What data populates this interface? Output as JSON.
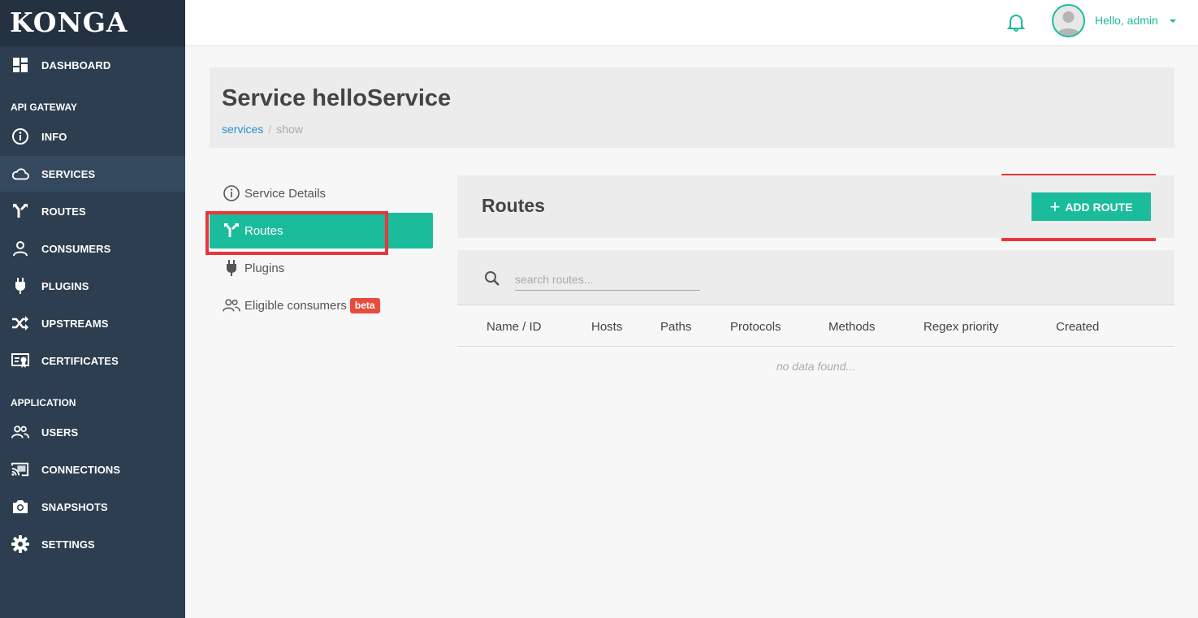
{
  "app": {
    "logo": "KONGA"
  },
  "sidebar": {
    "dashboard": "DASHBOARD",
    "section_api": "API GATEWAY",
    "api_items": [
      {
        "label": "INFO"
      },
      {
        "label": "SERVICES"
      },
      {
        "label": "ROUTES"
      },
      {
        "label": "CONSUMERS"
      },
      {
        "label": "PLUGINS"
      },
      {
        "label": "UPSTREAMS"
      },
      {
        "label": "CERTIFICATES"
      }
    ],
    "section_app": "APPLICATION",
    "app_items": [
      {
        "label": "USERS"
      },
      {
        "label": "CONNECTIONS"
      },
      {
        "label": "SNAPSHOTS"
      },
      {
        "label": "SETTINGS"
      }
    ],
    "active": "SERVICES"
  },
  "topbar": {
    "user_greeting": "Hello, admin"
  },
  "header": {
    "title": "Service helloService",
    "breadcrumb": {
      "link": "services",
      "separator": "/",
      "current": "show"
    }
  },
  "subnav": {
    "items": [
      {
        "label": "Service Details"
      },
      {
        "label": "Routes"
      },
      {
        "label": "Plugins"
      },
      {
        "label": "Eligible consumers"
      }
    ],
    "beta_badge": "beta",
    "active": "Routes"
  },
  "routes": {
    "title": "Routes",
    "add_button": "ADD ROUTE",
    "add_button_icon": "+",
    "search_placeholder": "search routes...",
    "columns": [
      "Name / ID",
      "Hosts",
      "Paths",
      "Protocols",
      "Methods",
      "Regex priority",
      "Created"
    ],
    "empty_text": "no data found..."
  },
  "colors": {
    "accent": "#1abc9c",
    "sidebar": "#2c3e50",
    "highlight": "#e8363b",
    "badge": "#e74c3c"
  }
}
